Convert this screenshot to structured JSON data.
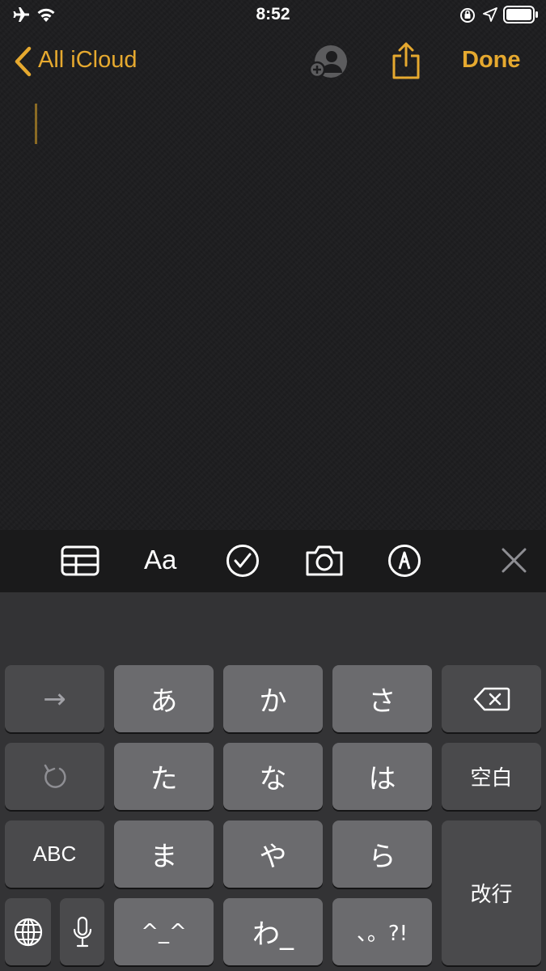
{
  "status_bar": {
    "time": "8:52"
  },
  "nav": {
    "back_label": "All iCloud",
    "done_label": "Done"
  },
  "toolbar": {
    "format_label": "Aa"
  },
  "keyboard": {
    "rows": [
      {
        "left": "→",
        "keys": [
          "あ",
          "か",
          "さ"
        ],
        "right_icon": "delete-icon"
      },
      {
        "left_icon": "undo-icon",
        "keys": [
          "た",
          "な",
          "は"
        ],
        "right": "空白"
      },
      {
        "left": "ABC",
        "keys": [
          "ま",
          "や",
          "ら"
        ],
        "right": "改行"
      },
      {
        "left_icons": [
          "globe-icon",
          "mic-icon"
        ],
        "keys": [
          "^_^",
          "わ_",
          "、。?!"
        ]
      }
    ]
  },
  "colors": {
    "accent": "#e6a92f",
    "key_light": "#6b6b6e",
    "key_dark": "#4a4a4c",
    "keyboard_bg": "#333335"
  }
}
